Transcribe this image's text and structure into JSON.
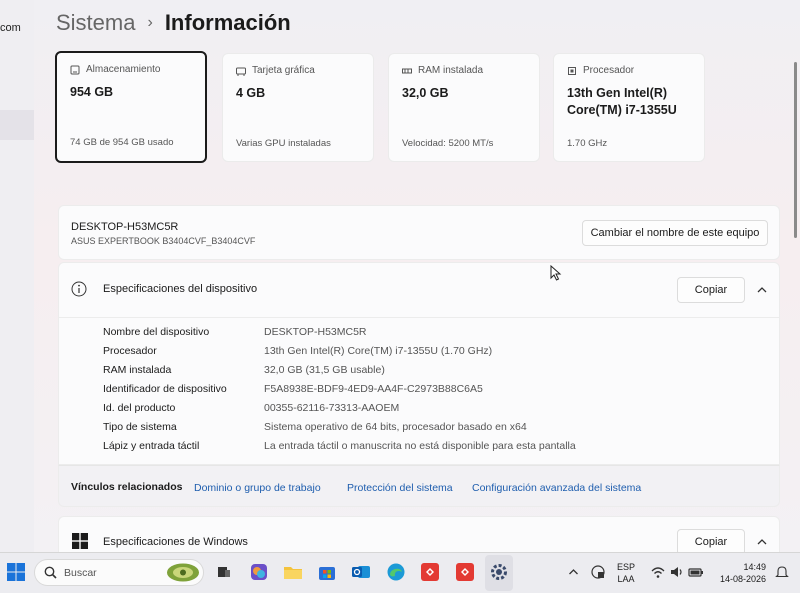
{
  "breadcrumb": {
    "parent": "Sistema",
    "separator": "›",
    "current": "Información"
  },
  "left_nav": {
    "partial_text": "com"
  },
  "summary_cards": [
    {
      "title": "Almacenamiento",
      "value": "954 GB",
      "sub": "74 GB de 954 GB usado",
      "icon": "storage-icon"
    },
    {
      "title": "Tarjeta gráfica",
      "value": "4 GB",
      "sub": "Varias GPU instaladas",
      "icon": "gpu-icon"
    },
    {
      "title": "RAM instalada",
      "value": "32,0 GB",
      "sub": "Velocidad: 5200 MT/s",
      "icon": "ram-icon"
    },
    {
      "title": "Procesador",
      "value_line1": "13th Gen Intel(R)",
      "value_line2": "Core(TM) i7-1355U",
      "sub": "1.70 GHz",
      "icon": "cpu-icon"
    }
  ],
  "device": {
    "name": "DESKTOP-H53MC5R",
    "model": "ASUS EXPERTBOOK B3404CVF_B3404CVF",
    "rename_button": "Cambiar el nombre de este equipo"
  },
  "device_specs": {
    "title": "Especificaciones del dispositivo",
    "copy_button": "Copiar",
    "rows": [
      {
        "label": "Nombre del dispositivo",
        "value": "DESKTOP-H53MC5R"
      },
      {
        "label": "Procesador",
        "value": "13th Gen Intel(R) Core(TM) i7-1355U (1.70 GHz)"
      },
      {
        "label": "RAM instalada",
        "value": "32,0 GB (31,5 GB usable)"
      },
      {
        "label": "Identificador de dispositivo",
        "value": "F5A8938E-BDF9-4ED9-AA4F-C2973B88C6A5"
      },
      {
        "label": "Id. del producto",
        "value": "00355-62116-73313-AAOEM"
      },
      {
        "label": "Tipo de sistema",
        "value": "Sistema operativo de 64 bits, procesador basado en x64"
      },
      {
        "label": "Lápiz y entrada táctil",
        "value": "La entrada táctil o manuscrita no está disponible para esta pantalla"
      }
    ]
  },
  "related": {
    "label": "Vínculos relacionados",
    "links": [
      "Dominio o grupo de trabajo",
      "Protección del sistema",
      "Configuración avanzada del sistema"
    ]
  },
  "windows_specs": {
    "title": "Especificaciones de Windows",
    "copy_button": "Copiar"
  },
  "taskbar": {
    "search_placeholder": "Buscar",
    "lang_line1": "ESP",
    "lang_line2": "LAA",
    "time": "14:49",
    "date": "14-08-2026"
  },
  "colors": {
    "accent": "#1f5eae",
    "text": "#1b1b1b",
    "secondary_text": "#555555"
  }
}
